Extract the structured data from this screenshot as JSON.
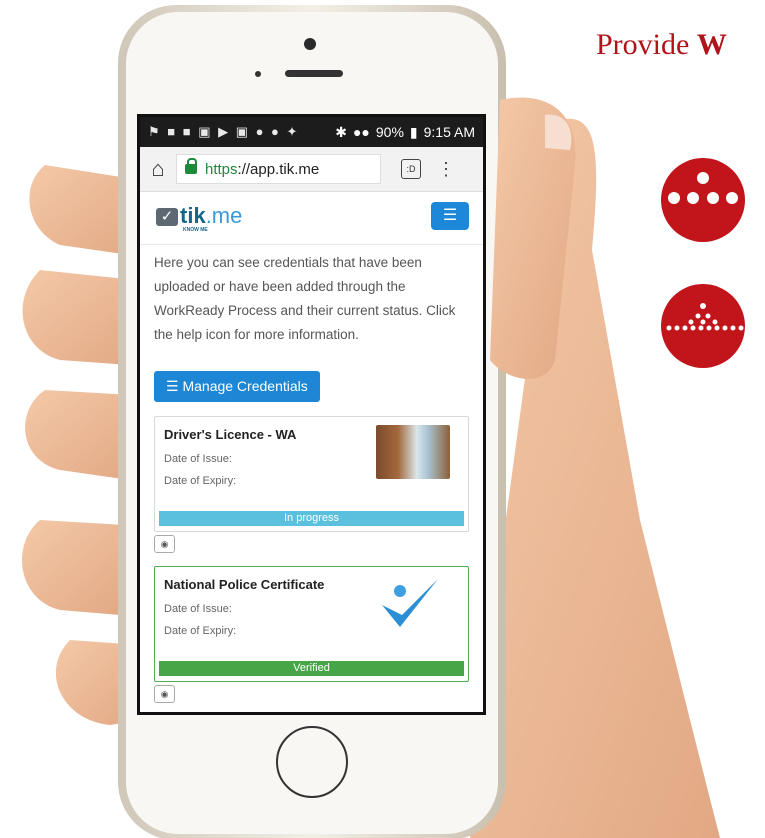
{
  "marketing": {
    "headline_prefix": "Provide ",
    "headline_bold": "W",
    "brand_color": "#b0141a"
  },
  "statusbar": {
    "left_icons": "⚑ ■ ■ ▣ ▶ ▣ ● ● ✦",
    "battery": "90%",
    "time": "9:15 AM"
  },
  "browser": {
    "url_scheme": "https",
    "url_rest": "://app.tik.me",
    "tab_count": ":D"
  },
  "app": {
    "logo": "tik",
    "logo_suffix": ".me",
    "logo_sub": "KNOW ME",
    "menu_icon": "menu-icon",
    "accent": "#1e88d8"
  },
  "credentials": {
    "description": "Here you can see credentials that have been uploaded or have been added through the WorkReady Process and their current status. Click the help icon for more information.",
    "manage_button": "Manage Credentials",
    "items": [
      {
        "title": "Driver's Licence - WA",
        "issue_label": "Date of Issue:",
        "expiry_label": "Date of Expiry:",
        "status": "In progress",
        "status_color": "#5bc0de"
      },
      {
        "title": "National Police Certificate",
        "issue_label": "Date of Issue:",
        "expiry_label": "Date of Expiry:",
        "status": "Verified",
        "status_color": "#47a447"
      }
    ]
  }
}
